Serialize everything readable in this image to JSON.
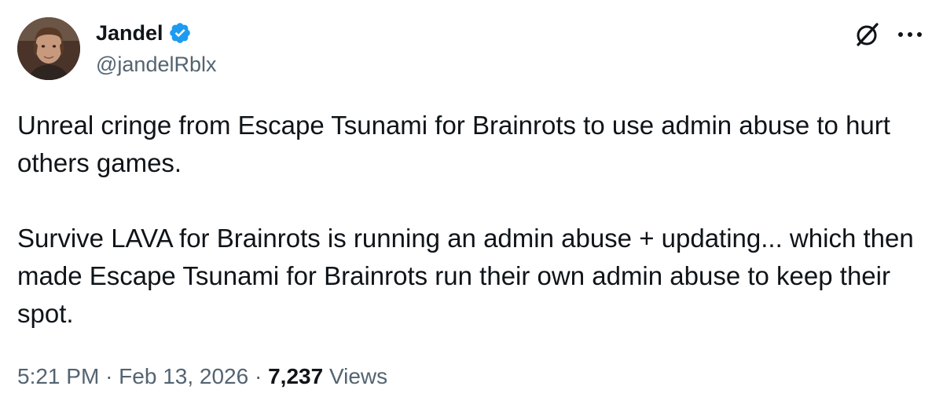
{
  "author": {
    "display_name": "Jandel",
    "handle": "@jandelRblx",
    "verified": true
  },
  "tweet": {
    "paragraphs": [
      "Unreal cringe from Escape Tsunami for Brainrots to use admin abuse to hurt others games.",
      "Survive LAVA for Brainrots is running an admin abuse + updating... which then made Escape Tsunami for Brainrots run their own admin abuse to keep their spot."
    ]
  },
  "meta": {
    "time": "5:21 PM",
    "separator": "·",
    "date": "Feb 13, 2026",
    "views_count": "7,237",
    "views_label": "Views"
  },
  "icons": {
    "verified": "verified-badge-icon",
    "grok": "grok-icon",
    "more": "more-options-icon"
  },
  "colors": {
    "verified_blue": "#1d9bf0",
    "text_primary": "#0f1419",
    "text_secondary": "#536471"
  }
}
